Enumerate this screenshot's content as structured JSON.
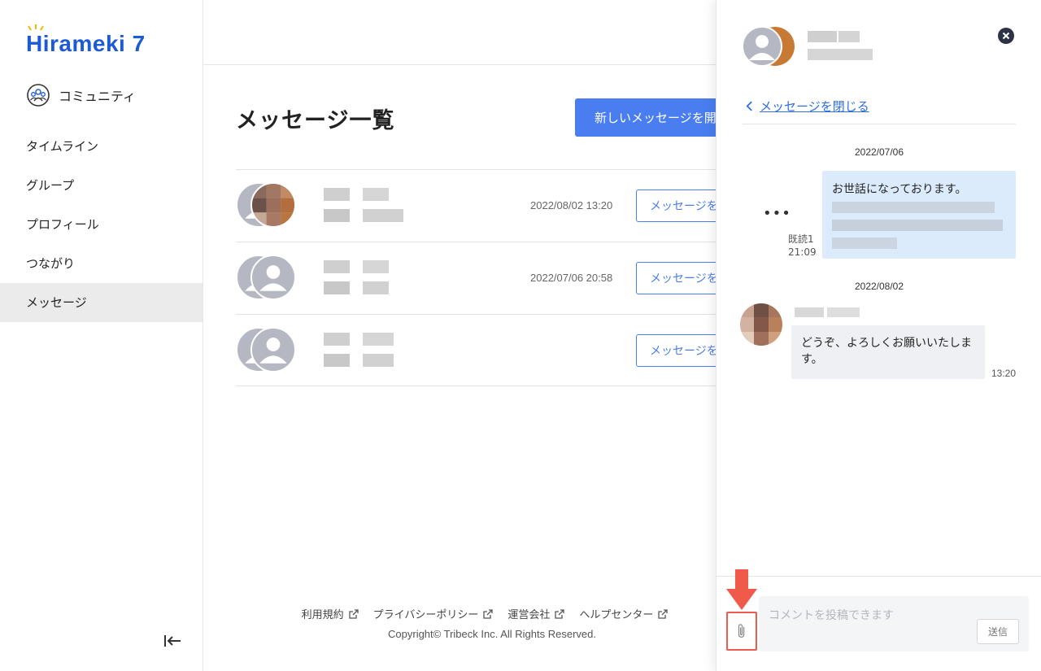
{
  "sidebar": {
    "logo": "Hirameki 7",
    "community_label": "コミュニティ",
    "items": [
      {
        "label": "タイムライン"
      },
      {
        "label": "グループ"
      },
      {
        "label": "プロフィール"
      },
      {
        "label": "つながり"
      },
      {
        "label": "メッセージ"
      }
    ],
    "active_item": "メッセージ"
  },
  "main": {
    "title": "メッセージ一覧",
    "new_message_button": "新しいメッセージを開始",
    "threads": [
      {
        "date": "2022/08/02 13:20",
        "button": "メッセージを表示"
      },
      {
        "date": "2022/07/06 20:58",
        "button": "メッセージを表示"
      },
      {
        "date": "",
        "button": "メッセージを表示"
      }
    ]
  },
  "footer": {
    "links": [
      "利用規約",
      "プライバシーポリシー",
      "運営会社",
      "ヘルプセンター"
    ],
    "copyright": "Copyright© Tribeck Inc. All Rights Reserved."
  },
  "panel": {
    "close_link": "メッセージを閉じる",
    "messages": [
      {
        "date": "2022/07/06",
        "text": "お世話になっております。",
        "read_label": "既読1",
        "time": "21:09"
      },
      {
        "date": "2022/08/02",
        "text": "どうぞ、よろしくお願いいたします。",
        "time": "13:20"
      }
    ],
    "composer_placeholder": "コメントを投稿できます",
    "send_button": "送信"
  },
  "colors": {
    "brand": "#1d5bd6",
    "primary": "#4a7ef0",
    "link": "#2f6de1",
    "my_bubble": "#dcebfb",
    "other_bubble": "#eef0f3",
    "highlight": "#f05a4a"
  }
}
